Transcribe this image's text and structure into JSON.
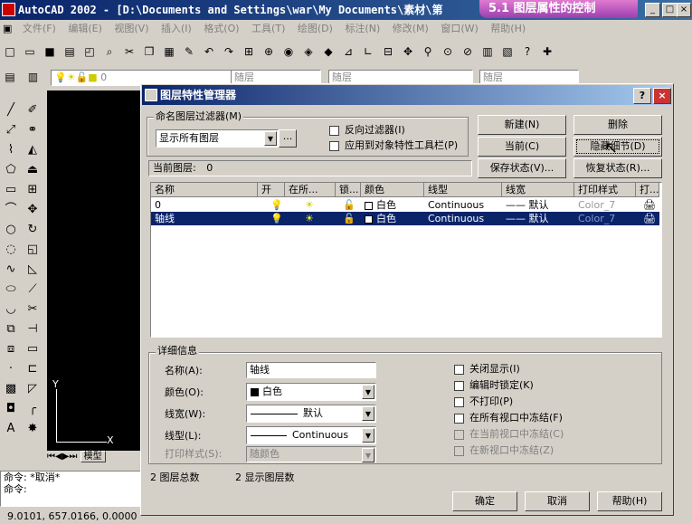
{
  "window": {
    "title": "AutoCAD 2002 - [D:\\Documents and Settings\\war\\My Documents\\素材\\第",
    "banner": "5.1 图层属性的控制",
    "min": "_",
    "max": "□",
    "close": "×"
  },
  "menu": [
    "文件(F)",
    "编辑(E)",
    "视图(V)",
    "插入(I)",
    "格式(O)",
    "工具(T)",
    "绘图(D)",
    "标注(N)",
    "修改(M)",
    "窗口(W)",
    "帮助(H)"
  ],
  "layerbar": {
    "layer_value": "0",
    "color_value": "随层",
    "linetype_value": "随层",
    "lineweight_value": "随层"
  },
  "drawing": {
    "axis_x": "X",
    "axis_y": "Y",
    "tab": "模型"
  },
  "command": {
    "line1": "命令: *取消*",
    "line2": "命令:"
  },
  "status": {
    "coords": "9.0101,   657.0166, 0.0000"
  },
  "dialog": {
    "title": "图层特性管理器",
    "help_btn": "?",
    "close_btn": "×",
    "filter_group": "命名图层过滤器(M)",
    "filter_value": "显示所有图层",
    "filter_more": "...",
    "invert_filter": "反向过滤器(I)",
    "apply_toolbar": "应用到对象特性工具栏(P)",
    "current_layer_label": "当前图层:",
    "current_layer_value": "0",
    "buttons": {
      "new": "新建(N)",
      "delete": "删除",
      "current": "当前(C)",
      "hide_details": "隐藏细节(D)",
      "save_state": "保存状态(V)...",
      "restore_state": "恢复状态(R)..."
    },
    "columns": [
      "名称",
      "开",
      "在所...",
      "锁...",
      "颜色",
      "线型",
      "线宽",
      "打印样式",
      "打..."
    ],
    "rows": [
      {
        "name": "0",
        "color": "白色",
        "linetype": "Continuous",
        "lineweight": "—— 默认",
        "plotstyle": "Color_7"
      },
      {
        "name": "轴线",
        "color": "白色",
        "linetype": "Continuous",
        "lineweight": "—— 默认",
        "plotstyle": "Color_7"
      }
    ],
    "details": {
      "group": "详细信息",
      "name_label": "名称(A):",
      "name_value": "轴线",
      "color_label": "颜色(O):",
      "color_value": "白色",
      "lineweight_label": "线宽(W):",
      "lineweight_value": "默认",
      "linetype_label": "线型(L):",
      "linetype_value": "Continuous",
      "plotstyle_label": "打印样式(S):",
      "plotstyle_value": "随颜色",
      "off": "关闭显示(I)",
      "lock": "编辑时锁定(K)",
      "noplot": "不打印(P)",
      "freeze_all": "在所有视口中冻结(F)",
      "freeze_current": "在当前视口中冻结(C)",
      "freeze_new": "在新视口中冻结(Z)"
    },
    "summary": {
      "total": "2 图层总数",
      "shown": "2 显示图层数"
    },
    "footer": {
      "ok": "确定",
      "cancel": "取消",
      "help": "帮助(H)"
    }
  }
}
